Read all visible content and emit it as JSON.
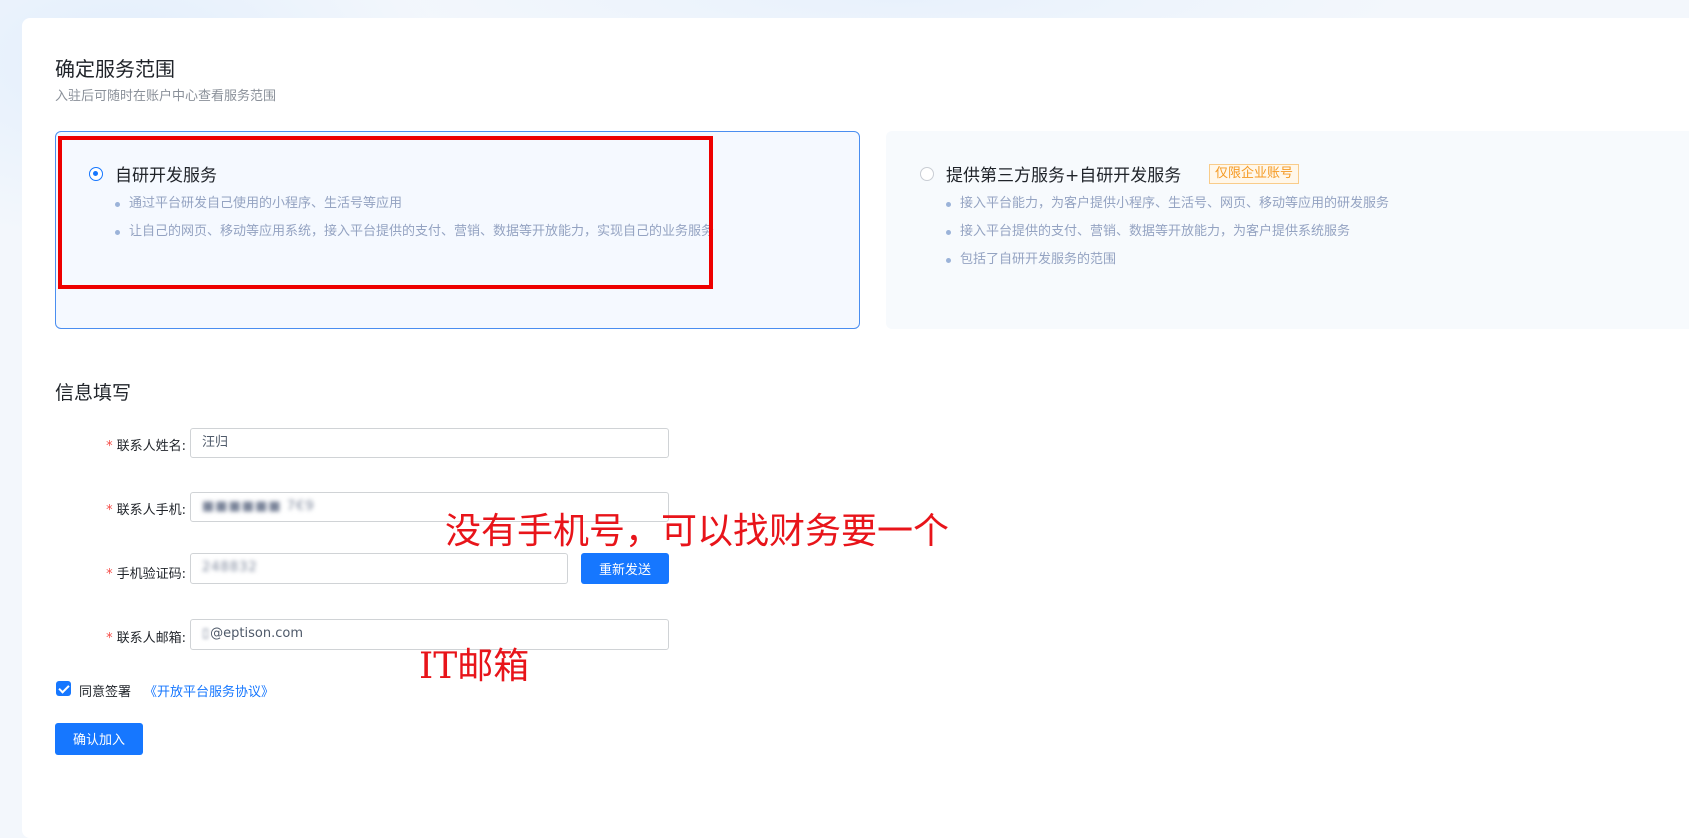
{
  "scope": {
    "title": "确定服务范围",
    "subtitle": "入驻后可随时在账户中心查看服务范围",
    "options": [
      {
        "title": "自研开发服务",
        "selected": true,
        "bullets": [
          "通过平台研发自己使用的小程序、生活号等应用",
          "让自己的网页、移动等应用系统，接入平台提供的支付、营销、数据等开放能力，实现自己的业务服务"
        ]
      },
      {
        "title": "提供第三方服务+自研开发服务",
        "selected": false,
        "tag": "仅限企业账号",
        "bullets": [
          "接入平台能力，为客户提供小程序、生活号、网页、移动等应用的研发服务",
          "接入平台提供的支付、营销、数据等开放能力，为客户提供系统服务",
          "包括了自研开发服务的范围"
        ]
      }
    ]
  },
  "form": {
    "title": "信息填写",
    "name_label": "联系人姓名:",
    "name_value": "汪归",
    "phone_label": "联系人手机:",
    "phone_value": "■■■■■■ 7€9",
    "code_label": "手机验证码:",
    "code_value": "248832",
    "resend_label": "重新发送",
    "email_label": "联系人邮箱:",
    "email_value": "@eptison.com",
    "agree_text": "同意签署",
    "agreement_link": "《开放平台服务协议》",
    "submit_label": "确认加入"
  },
  "annotations": {
    "phone_note": "没有手机号，可以找财务要一个",
    "email_note": "IT邮箱"
  },
  "colors": {
    "primary": "#1677ff",
    "annotation": "#e8141a",
    "tag": "#f59a23"
  }
}
